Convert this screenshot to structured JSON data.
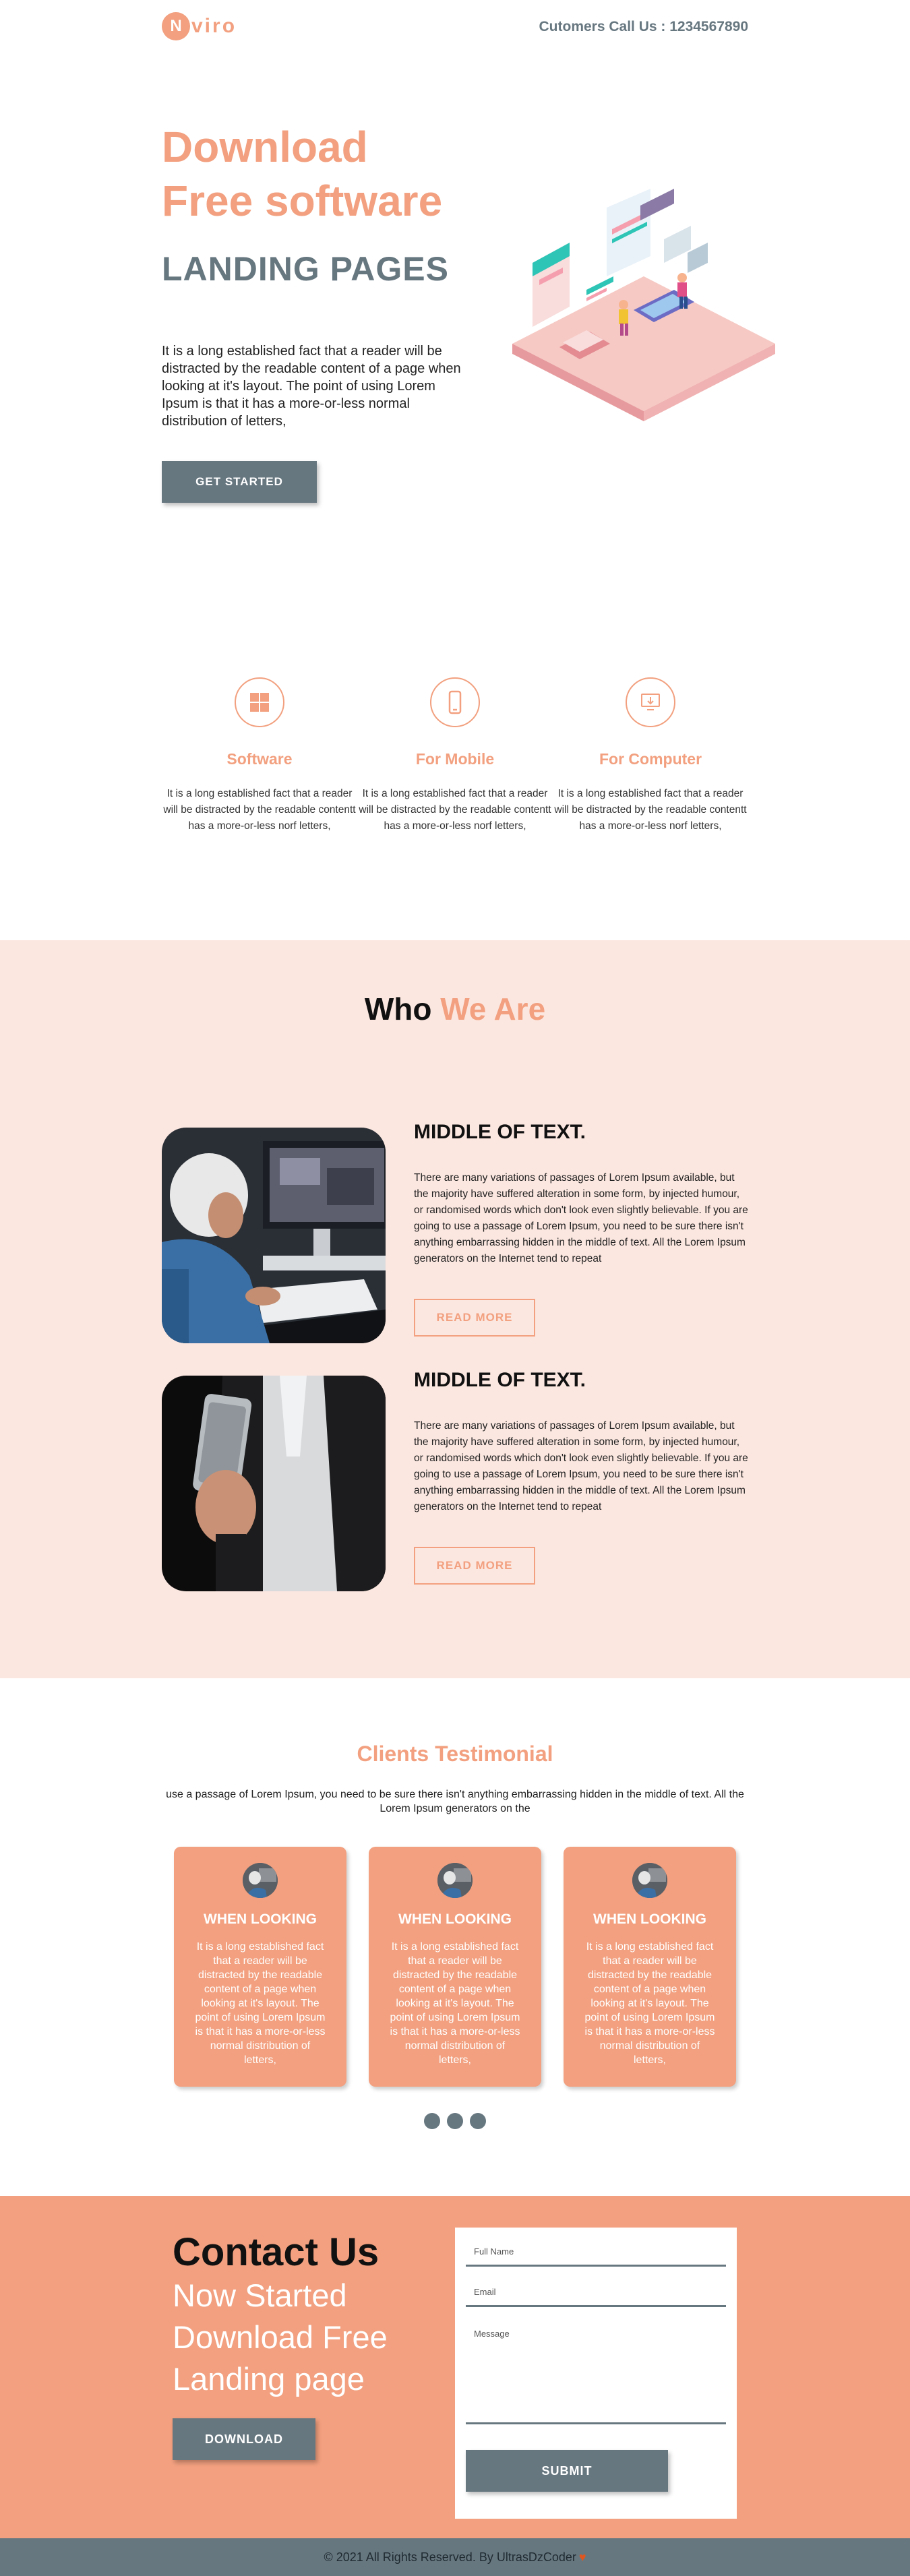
{
  "header": {
    "logo_letter": "N",
    "logo_rest": "viro",
    "phone_text": "Cutomers Call Us : 1234567890"
  },
  "hero": {
    "title_line1": "Download",
    "title_line2": "Free software",
    "subtitle": "LANDING PAGES",
    "text": "It is a long established fact that a reader will be distracted by the readable content of a page when looking at it's layout. The point of using Lorem Ipsum is that it has a more-or-less normal distribution of letters,",
    "button_label": "GET STARTED"
  },
  "features": [
    {
      "icon": "windows-icon",
      "title": "Software",
      "text": "It is a long established fact that a reader will be distracted by the readable contentt has a more-or-less norf letters,"
    },
    {
      "icon": "mobile-icon",
      "title": "For Mobile",
      "text": "It is a long established fact that a reader will be distracted by the readable contentt has a more-or-less norf letters,"
    },
    {
      "icon": "computer-download-icon",
      "title": "For Computer",
      "text": "It is a long established fact that a reader will be distracted by the readable contentt has a more-or-less norf letters,"
    }
  ],
  "who": {
    "title_dark": "Who",
    "title_accent": "We Are",
    "items": [
      {
        "heading": "MIDDLE OF TEXT.",
        "text": "There are many variations of passages of Lorem Ipsum available, but the majority have suffered alteration in some form, by injected humour, or randomised words which don't look even slightly believable. If you are going to use a passage of Lorem Ipsum, you need to be sure there isn't anything embarrassing hidden in the middle of text. All the Lorem Ipsum generators on the Internet tend to repeat",
        "button_label": "READ MORE"
      },
      {
        "heading": "MIDDLE OF TEXT.",
        "text": "There are many variations of passages of Lorem Ipsum available, but the majority have suffered alteration in some form, by injected humour, or randomised words which don't look even slightly believable. If you are going to use a passage of Lorem Ipsum, you need to be sure there isn't anything embarrassing hidden in the middle of text. All the Lorem Ipsum generators on the Internet tend to repeat",
        "button_label": "READ MORE"
      }
    ]
  },
  "testimonial": {
    "title": "Clients Testimonial",
    "subtitle": "use a passage of Lorem Ipsum, you need to be sure there isn't anything embarrassing hidden in the middle of text. All the Lorem Ipsum generators on the",
    "cards": [
      {
        "heading": "WHEN LOOKING",
        "text": "It is a long established fact that a reader will be distracted by the readable content of a page when looking at it's layout. The point of using Lorem Ipsum is that it has a more-or-less normal distribution of letters,"
      },
      {
        "heading": "WHEN LOOKING",
        "text": "It is a long established fact that a reader will be distracted by the readable content of a page when looking at it's layout. The point of using Lorem Ipsum is that it has a more-or-less normal distribution of letters,"
      },
      {
        "heading": "WHEN LOOKING",
        "text": "It is a long established fact that a reader will be distracted by the readable content of a page when looking at it's layout. The point of using Lorem Ipsum is that it has a more-or-less normal distribution of letters,"
      }
    ]
  },
  "contact": {
    "title": "Contact Us",
    "sub_line1": "Now Started",
    "sub_line2": "Download Free",
    "sub_line3": "Landing page",
    "button_label": "DOWNLOAD",
    "form": {
      "name_placeholder": "Full Name",
      "email_placeholder": "Email",
      "message_placeholder": "Message",
      "submit_label": "SUBMIT"
    }
  },
  "footer": {
    "text": "© 2021 All Rights Reserved. By UltrasDzCoder"
  },
  "colors": {
    "accent": "#f2a07f",
    "slate": "#677780",
    "blush": "#fce7e0"
  }
}
